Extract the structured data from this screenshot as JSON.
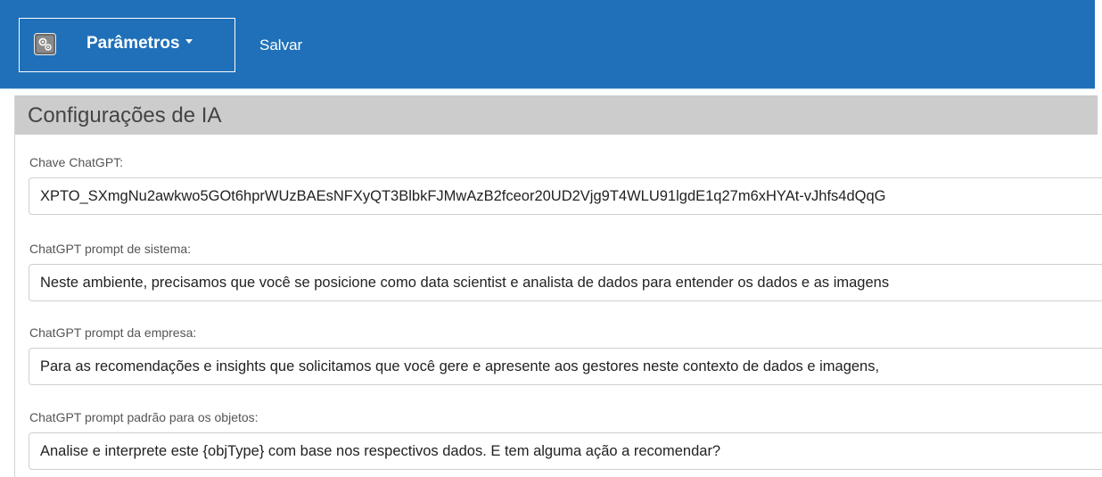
{
  "toolbar": {
    "menu_label": "Parâmetros",
    "menu_icon": "settings-gear-icon",
    "save_label": "Salvar"
  },
  "panel": {
    "title": "Configurações de IA"
  },
  "fields": [
    {
      "label": "Chave ChatGPT:",
      "value": "XPTO_SXmgNu2awkwo5GOt6hprWUzBAEsNFXyQT3BlbkFJMwAzB2fceor20UD2Vjg9T4WLU91lgdE1q27m6xHYAt-vJhfs4dQqG"
    },
    {
      "label": "ChatGPT prompt de sistema:",
      "value": "Neste ambiente, precisamos que você se posicione como data scientist e analista de dados para entender os dados e as imagens"
    },
    {
      "label": "ChatGPT prompt da empresa:",
      "value": "Para as recomendações e insights que solicitamos que você gere e apresente aos gestores neste contexto de dados e imagens,"
    },
    {
      "label": "ChatGPT prompt padrão para os objetos:",
      "value": "Analise e interprete este {objType} com base nos respectivos dados. E tem alguma ação a recomendar?"
    }
  ],
  "colors": {
    "topbar": "#1f70b8",
    "panel_header": "#cccccc"
  }
}
